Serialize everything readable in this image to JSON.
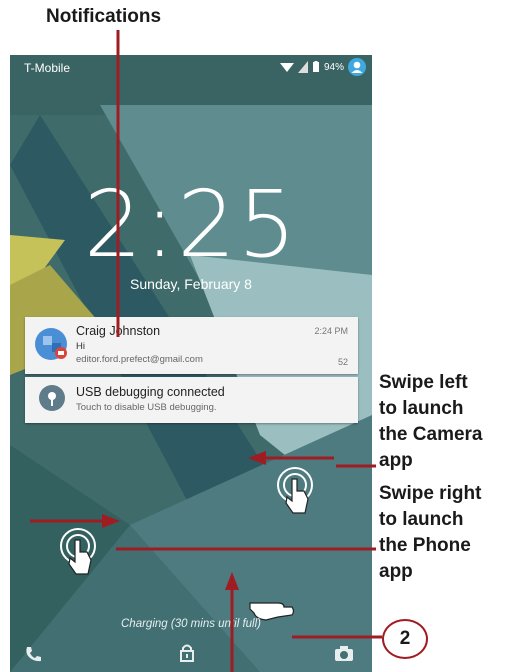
{
  "callout_notifications": "Notifications",
  "status_bar": {
    "carrier": "T-Mobile",
    "battery_percent": "94%"
  },
  "lockscreen": {
    "time": "2:25",
    "date": "Sunday, February 8",
    "charging_text": "Charging (30 mins until full)"
  },
  "notifications": [
    {
      "title": "Craig Johnston",
      "line1": "Hi",
      "line2": "editor.ford.prefect@gmail.com",
      "time": "2:24 PM",
      "count": "52",
      "icon": "gmail-avatar-icon"
    },
    {
      "title": "USB debugging connected",
      "line1": "Touch to disable USB debugging.",
      "icon": "android-debug-icon"
    }
  ],
  "callout_camera": [
    "Swipe left",
    "to launch",
    "the Camera",
    "app"
  ],
  "callout_phone": [
    "Swipe right",
    "to launch",
    "the Phone",
    "app"
  ],
  "step_number": "2",
  "bottom_bar": {
    "left_icon": "phone-icon",
    "center_icon": "lock-icon",
    "right_icon": "camera-icon"
  },
  "colors": {
    "callout": "#a01c23",
    "wallpaper_teal": "#3f6b6a",
    "wallpaper_light": "#a7c6c7"
  }
}
